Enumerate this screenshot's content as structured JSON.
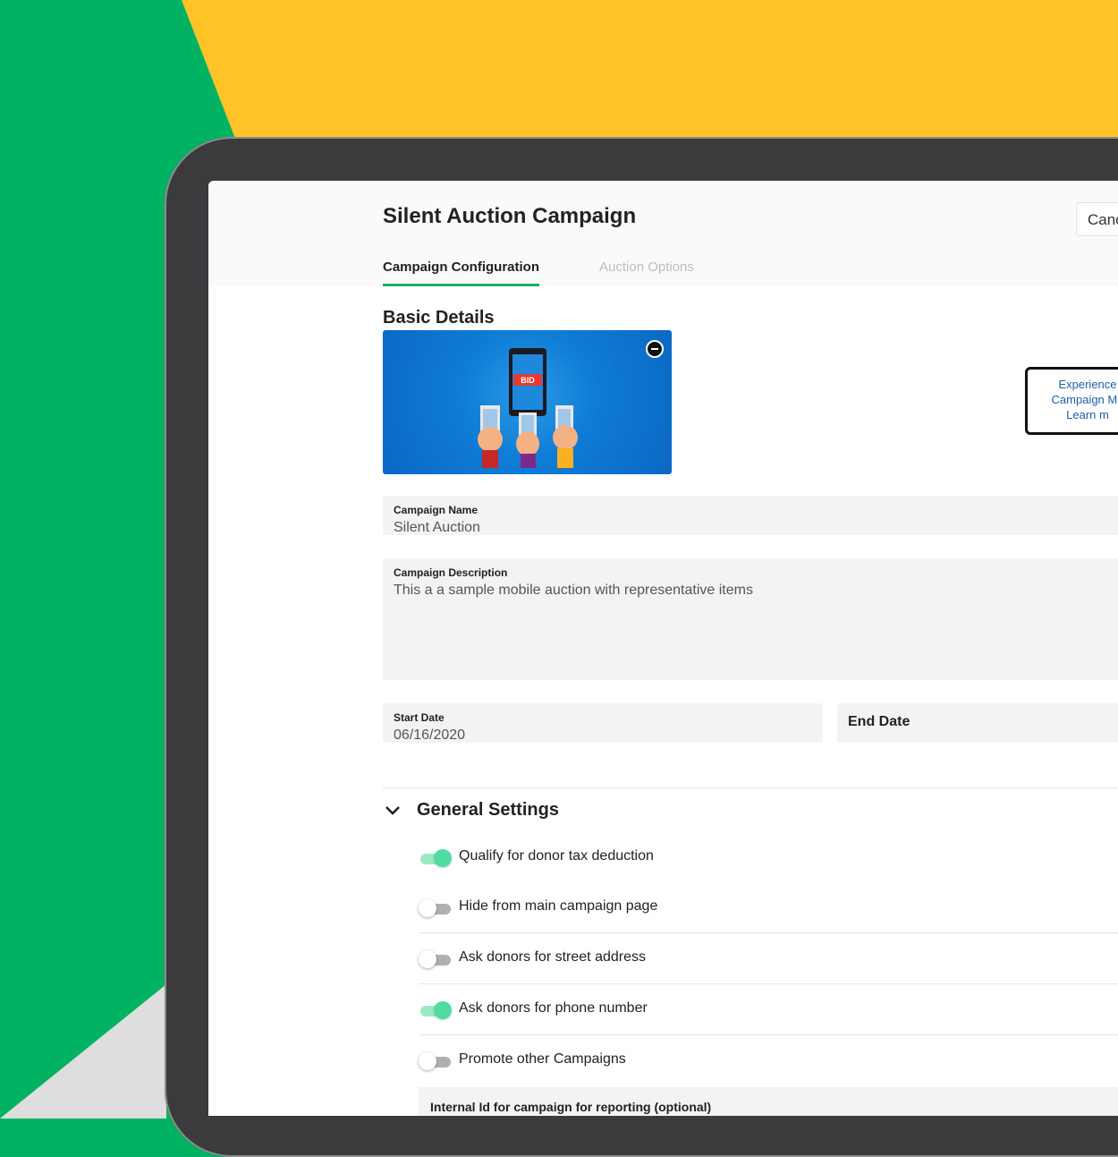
{
  "page": {
    "title": "Silent Auction Campaign",
    "cancel_label": "Canc"
  },
  "tabs": [
    {
      "label": "Campaign Configuration",
      "active": true
    },
    {
      "label": "Auction Options",
      "active": false
    }
  ],
  "basic_details": {
    "heading": "Basic Details",
    "banner": {
      "badge_text": "BID",
      "icon": "bid-phone-hands-illustration"
    },
    "promo_card": {
      "lines": [
        "Experience",
        "Campaign Ma",
        "Learn m"
      ]
    },
    "campaign_name": {
      "label": "Campaign Name",
      "value": "Silent Auction"
    },
    "campaign_description": {
      "label": "Campaign Description",
      "value": "This a a sample mobile auction with representative items"
    },
    "start_date": {
      "label": "Start Date",
      "value": "06/16/2020"
    },
    "end_date": {
      "label": "End Date",
      "value": ""
    }
  },
  "general_settings": {
    "heading": "General Settings",
    "toggles": [
      {
        "label": "Qualify for donor tax deduction",
        "on": true
      },
      {
        "label": "Hide from main campaign page",
        "on": false
      },
      {
        "label": "Ask donors for street address",
        "on": false
      },
      {
        "label": "Ask donors for phone number",
        "on": true
      },
      {
        "label": "Promote other Campaigns",
        "on": false
      }
    ],
    "internal_id_label": "Internal Id for campaign for reporting (optional)"
  },
  "colors": {
    "accent_green": "#18b060",
    "toggle_on": "#4fdca0",
    "background_green": "#00b262",
    "background_yellow": "#ffc328",
    "banner_blue": "#0f7cd6"
  }
}
